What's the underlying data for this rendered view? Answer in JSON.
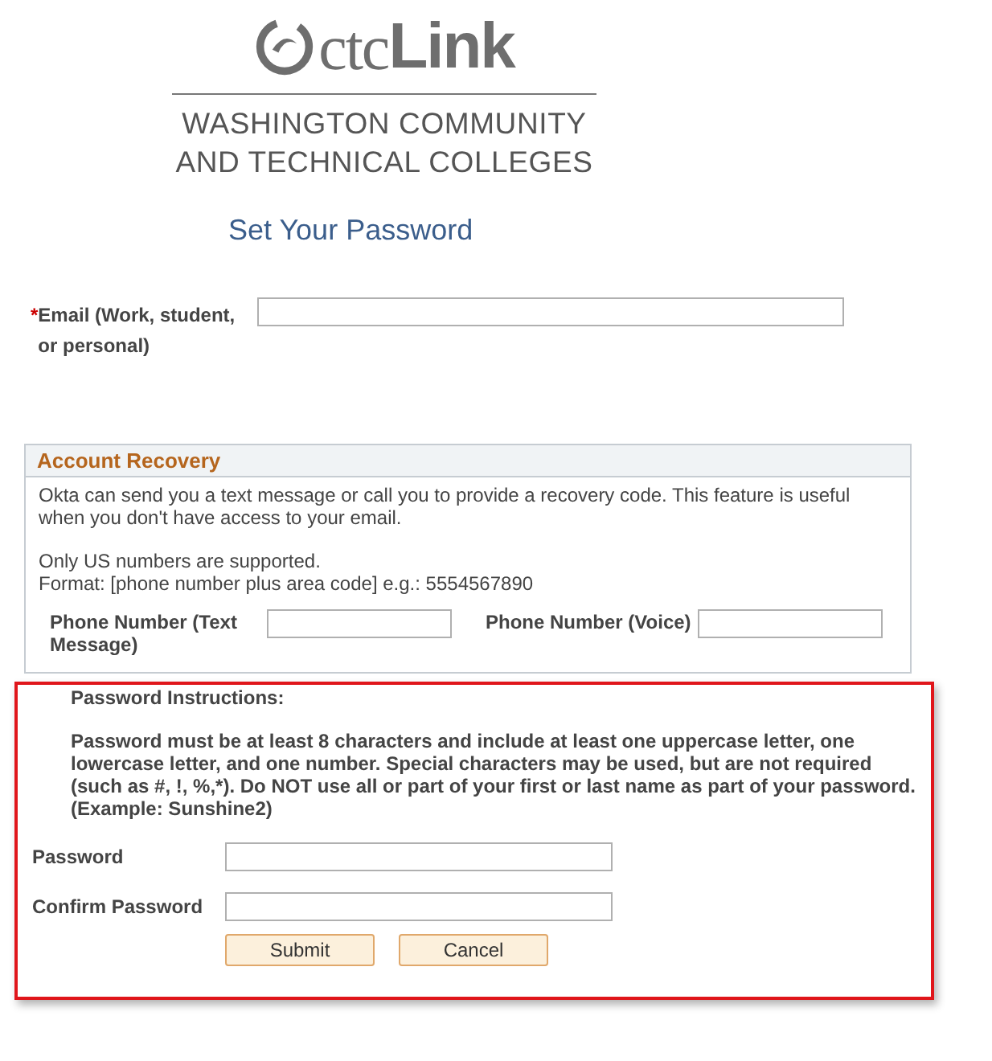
{
  "logo": {
    "part_1": "ctc",
    "part_2": "Link",
    "line_1": "WASHINGTON COMMUNITY",
    "line_2": "AND TECHNICAL COLLEGES"
  },
  "title": "Set Your Password",
  "email": {
    "required_mark": "*",
    "label": "Email (Work, student, or personal)"
  },
  "account_recovery": {
    "title": "Account Recovery",
    "paragraphs": [
      "Okta can send you a text message or call you to provide a recovery code. This feature is useful when you don't have access to your email.",
      "Only US numbers are supported.\nFormat: [phone number plus area code] e.g.: 5554567890"
    ],
    "fields": [
      {
        "label": "Phone Number (Text Message)"
      },
      {
        "label": "Phone Number (Voice)"
      }
    ]
  },
  "password_section": {
    "highlighted": true,
    "heading": "Password Instructions:",
    "instructions": "Password must be at least 8 characters and include at least one uppercase letter, one lowercase letter, and one number. Special characters may be used, but are not required (such as #, !, %,*). Do NOT use all or part of your first or last name as part of your password. (Example: Sunshine2)",
    "fields": [
      {
        "label": "Password"
      },
      {
        "label": "Confirm Password"
      }
    ],
    "buttons": [
      "Submit",
      "Cancel"
    ]
  }
}
